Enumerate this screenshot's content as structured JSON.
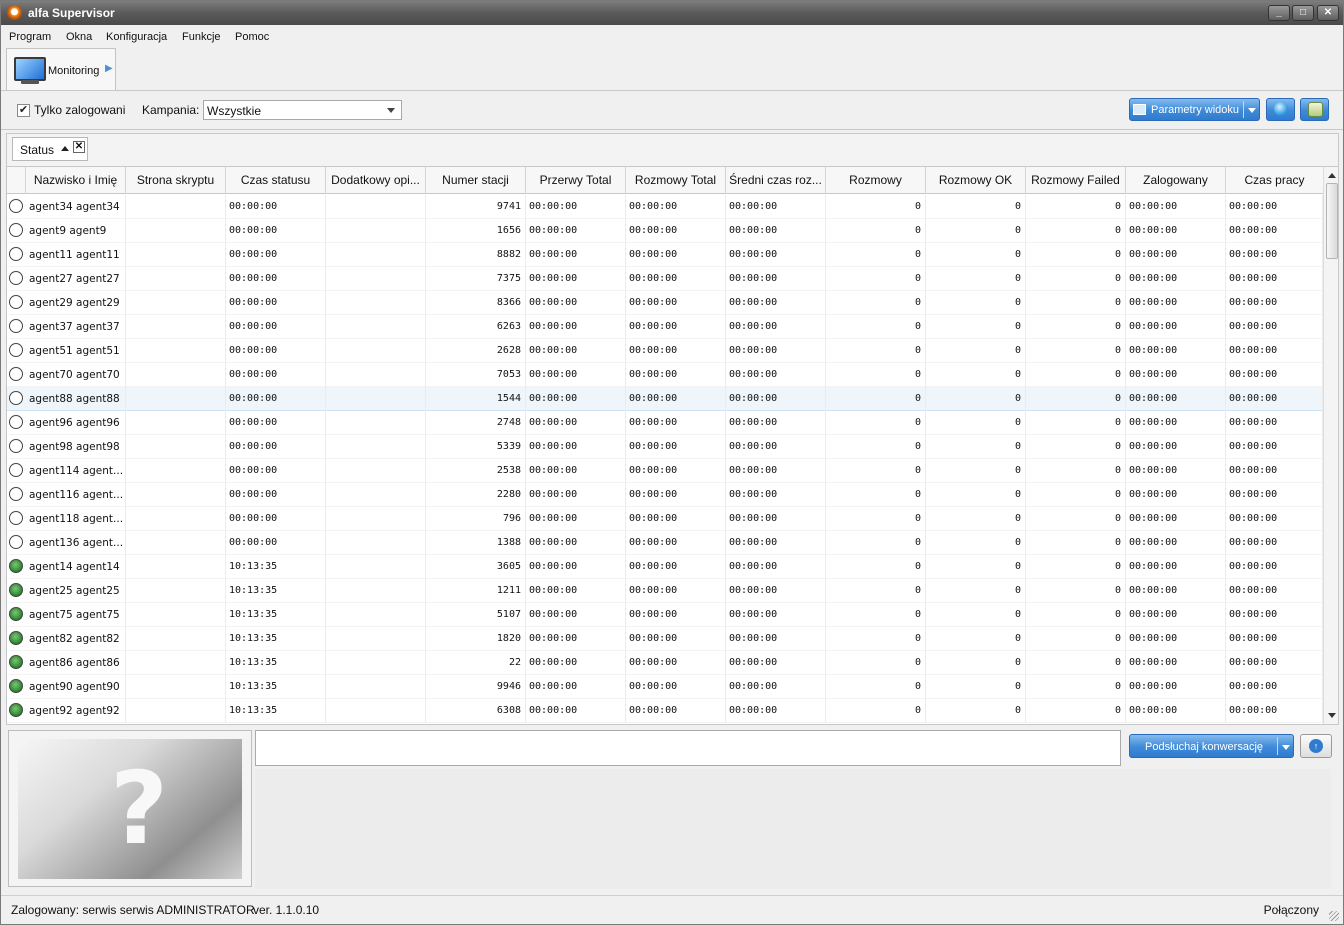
{
  "window": {
    "title": "alfa Supervisor",
    "controls": [
      "_",
      "□",
      "✕"
    ]
  },
  "menu": [
    "Program",
    "Okna",
    "Konfiguracja",
    "Funkcje",
    "Pomoc"
  ],
  "tab": {
    "label": "Monitoring"
  },
  "filters": {
    "only_logged_label": "Tylko zalogowani",
    "only_logged_checked": true,
    "campaign_label": "Kampania:",
    "campaign_value": "Wszystkie",
    "params_button": "Parametry widoku"
  },
  "group": {
    "label": "Status",
    "sort": "ascending"
  },
  "columns": [
    "",
    "Nazwisko i Imię",
    "Strona skryptu",
    "Czas statusu",
    "Dodatkowy opi...",
    "Numer stacji",
    "Przerwy Total",
    "Rozmowy Total",
    "Średni czas roz...",
    "Rozmowy",
    "Rozmowy OK",
    "Rozmowy Failed",
    "Zalogowany",
    "Czas pracy"
  ],
  "rows": [
    {
      "status": "offline",
      "name": "agent34 agent34",
      "script": "",
      "status_time": "00:00:00",
      "extra": "",
      "station": "9741",
      "breaks": "00:00:00",
      "calls_total": "00:00:00",
      "avg": "00:00:00",
      "calls": "0",
      "ok": "0",
      "failed": "0",
      "logged": "00:00:00",
      "work": "00:00:00"
    },
    {
      "status": "offline",
      "name": "agent9 agent9",
      "script": "",
      "status_time": "00:00:00",
      "extra": "",
      "station": "1656",
      "breaks": "00:00:00",
      "calls_total": "00:00:00",
      "avg": "00:00:00",
      "calls": "0",
      "ok": "0",
      "failed": "0",
      "logged": "00:00:00",
      "work": "00:00:00"
    },
    {
      "status": "offline",
      "name": "agent11 agent11",
      "script": "",
      "status_time": "00:00:00",
      "extra": "",
      "station": "8882",
      "breaks": "00:00:00",
      "calls_total": "00:00:00",
      "avg": "00:00:00",
      "calls": "0",
      "ok": "0",
      "failed": "0",
      "logged": "00:00:00",
      "work": "00:00:00"
    },
    {
      "status": "offline",
      "name": "agent27 agent27",
      "script": "",
      "status_time": "00:00:00",
      "extra": "",
      "station": "7375",
      "breaks": "00:00:00",
      "calls_total": "00:00:00",
      "avg": "00:00:00",
      "calls": "0",
      "ok": "0",
      "failed": "0",
      "logged": "00:00:00",
      "work": "00:00:00"
    },
    {
      "status": "offline",
      "name": "agent29 agent29",
      "script": "",
      "status_time": "00:00:00",
      "extra": "",
      "station": "8366",
      "breaks": "00:00:00",
      "calls_total": "00:00:00",
      "avg": "00:00:00",
      "calls": "0",
      "ok": "0",
      "failed": "0",
      "logged": "00:00:00",
      "work": "00:00:00"
    },
    {
      "status": "offline",
      "name": "agent37 agent37",
      "script": "",
      "status_time": "00:00:00",
      "extra": "",
      "station": "6263",
      "breaks": "00:00:00",
      "calls_total": "00:00:00",
      "avg": "00:00:00",
      "calls": "0",
      "ok": "0",
      "failed": "0",
      "logged": "00:00:00",
      "work": "00:00:00"
    },
    {
      "status": "offline",
      "name": "agent51 agent51",
      "script": "",
      "status_time": "00:00:00",
      "extra": "",
      "station": "2628",
      "breaks": "00:00:00",
      "calls_total": "00:00:00",
      "avg": "00:00:00",
      "calls": "0",
      "ok": "0",
      "failed": "0",
      "logged": "00:00:00",
      "work": "00:00:00"
    },
    {
      "status": "offline",
      "name": "agent70 agent70",
      "script": "",
      "status_time": "00:00:00",
      "extra": "",
      "station": "7053",
      "breaks": "00:00:00",
      "calls_total": "00:00:00",
      "avg": "00:00:00",
      "calls": "0",
      "ok": "0",
      "failed": "0",
      "logged": "00:00:00",
      "work": "00:00:00"
    },
    {
      "status": "offline",
      "name": "agent88 agent88",
      "script": "",
      "status_time": "00:00:00",
      "extra": "",
      "station": "1544",
      "breaks": "00:00:00",
      "calls_total": "00:00:00",
      "avg": "00:00:00",
      "calls": "0",
      "ok": "0",
      "failed": "0",
      "logged": "00:00:00",
      "work": "00:00:00",
      "selected": true
    },
    {
      "status": "offline",
      "name": "agent96 agent96",
      "script": "",
      "status_time": "00:00:00",
      "extra": "",
      "station": "2748",
      "breaks": "00:00:00",
      "calls_total": "00:00:00",
      "avg": "00:00:00",
      "calls": "0",
      "ok": "0",
      "failed": "0",
      "logged": "00:00:00",
      "work": "00:00:00"
    },
    {
      "status": "offline",
      "name": "agent98 agent98",
      "script": "",
      "status_time": "00:00:00",
      "extra": "",
      "station": "5339",
      "breaks": "00:00:00",
      "calls_total": "00:00:00",
      "avg": "00:00:00",
      "calls": "0",
      "ok": "0",
      "failed": "0",
      "logged": "00:00:00",
      "work": "00:00:00"
    },
    {
      "status": "offline",
      "name": "agent114 agent...",
      "script": "",
      "status_time": "00:00:00",
      "extra": "",
      "station": "2538",
      "breaks": "00:00:00",
      "calls_total": "00:00:00",
      "avg": "00:00:00",
      "calls": "0",
      "ok": "0",
      "failed": "0",
      "logged": "00:00:00",
      "work": "00:00:00"
    },
    {
      "status": "offline",
      "name": "agent116 agent...",
      "script": "",
      "status_time": "00:00:00",
      "extra": "",
      "station": "2280",
      "breaks": "00:00:00",
      "calls_total": "00:00:00",
      "avg": "00:00:00",
      "calls": "0",
      "ok": "0",
      "failed": "0",
      "logged": "00:00:00",
      "work": "00:00:00"
    },
    {
      "status": "offline",
      "name": "agent118 agent...",
      "script": "",
      "status_time": "00:00:00",
      "extra": "",
      "station": "796",
      "breaks": "00:00:00",
      "calls_total": "00:00:00",
      "avg": "00:00:00",
      "calls": "0",
      "ok": "0",
      "failed": "0",
      "logged": "00:00:00",
      "work": "00:00:00"
    },
    {
      "status": "offline",
      "name": "agent136 agent...",
      "script": "",
      "status_time": "00:00:00",
      "extra": "",
      "station": "1388",
      "breaks": "00:00:00",
      "calls_total": "00:00:00",
      "avg": "00:00:00",
      "calls": "0",
      "ok": "0",
      "failed": "0",
      "logged": "00:00:00",
      "work": "00:00:00"
    },
    {
      "status": "online",
      "name": "agent14 agent14",
      "script": "",
      "status_time": "10:13:35",
      "extra": "",
      "station": "3605",
      "breaks": "00:00:00",
      "calls_total": "00:00:00",
      "avg": "00:00:00",
      "calls": "0",
      "ok": "0",
      "failed": "0",
      "logged": "00:00:00",
      "work": "00:00:00"
    },
    {
      "status": "online",
      "name": "agent25 agent25",
      "script": "",
      "status_time": "10:13:35",
      "extra": "",
      "station": "1211",
      "breaks": "00:00:00",
      "calls_total": "00:00:00",
      "avg": "00:00:00",
      "calls": "0",
      "ok": "0",
      "failed": "0",
      "logged": "00:00:00",
      "work": "00:00:00"
    },
    {
      "status": "online",
      "name": "agent75 agent75",
      "script": "",
      "status_time": "10:13:35",
      "extra": "",
      "station": "5107",
      "breaks": "00:00:00",
      "calls_total": "00:00:00",
      "avg": "00:00:00",
      "calls": "0",
      "ok": "0",
      "failed": "0",
      "logged": "00:00:00",
      "work": "00:00:00"
    },
    {
      "status": "online",
      "name": "agent82 agent82",
      "script": "",
      "status_time": "10:13:35",
      "extra": "",
      "station": "1820",
      "breaks": "00:00:00",
      "calls_total": "00:00:00",
      "avg": "00:00:00",
      "calls": "0",
      "ok": "0",
      "failed": "0",
      "logged": "00:00:00",
      "work": "00:00:00"
    },
    {
      "status": "online",
      "name": "agent86 agent86",
      "script": "",
      "status_time": "10:13:35",
      "extra": "",
      "station": "22",
      "breaks": "00:00:00",
      "calls_total": "00:00:00",
      "avg": "00:00:00",
      "calls": "0",
      "ok": "0",
      "failed": "0",
      "logged": "00:00:00",
      "work": "00:00:00"
    },
    {
      "status": "online",
      "name": "agent90 agent90",
      "script": "",
      "status_time": "10:13:35",
      "extra": "",
      "station": "9946",
      "breaks": "00:00:00",
      "calls_total": "00:00:00",
      "avg": "00:00:00",
      "calls": "0",
      "ok": "0",
      "failed": "0",
      "logged": "00:00:00",
      "work": "00:00:00"
    },
    {
      "status": "online",
      "name": "agent92 agent92",
      "script": "",
      "status_time": "10:13:35",
      "extra": "",
      "station": "6308",
      "breaks": "00:00:00",
      "calls_total": "00:00:00",
      "avg": "00:00:00",
      "calls": "0",
      "ok": "0",
      "failed": "0",
      "logged": "00:00:00",
      "work": "00:00:00"
    }
  ],
  "bottom": {
    "photo_placeholder": "?",
    "message_value": "",
    "listen_button": "Podsłuchaj konwersację"
  },
  "statusbar": {
    "user": "Zalogowany: serwis serwis ADMINISTRATOR",
    "version": "ver. 1.1.0.10",
    "connection": "Połączony"
  },
  "colors": {
    "accent": "#3f8ad8",
    "online": "#2d8a2d",
    "selected_row": "#eef5fb"
  },
  "icons": {
    "app": "alfa-logo-icon",
    "tab": "monitor-icon",
    "globe": "globe-icon",
    "refresh": "refresh-icon",
    "up": "arrow-up-icon"
  }
}
